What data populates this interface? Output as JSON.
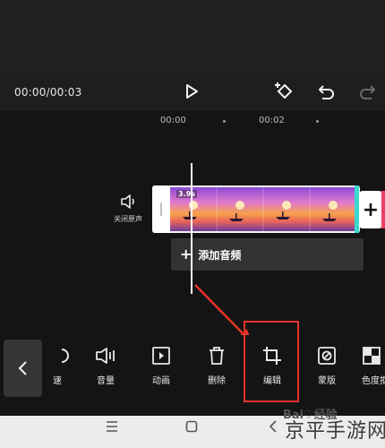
{
  "player": {
    "timecode": "00:00/00:03"
  },
  "controls": {
    "play_icon": "play-icon",
    "keyframe_icon": "keyframe-add-icon",
    "undo_icon": "undo-icon",
    "redo_icon": "redo-icon"
  },
  "ruler": {
    "ticks": [
      "00:00",
      "00:02"
    ]
  },
  "track": {
    "mute_label": "关闭原声",
    "clip_duration": "3.9s",
    "add_button": "+",
    "add_audio_plus": "+",
    "add_audio_label": "添加音频"
  },
  "toolbar": {
    "items": [
      {
        "label": "速",
        "icon": "speed-icon"
      },
      {
        "label": "音量",
        "icon": "volume-icon"
      },
      {
        "label": "动画",
        "icon": "animation-icon"
      },
      {
        "label": "删除",
        "icon": "trash-icon"
      },
      {
        "label": "编辑",
        "icon": "crop-icon"
      },
      {
        "label": "蒙版",
        "icon": "mask-icon"
      },
      {
        "label": "色度抠",
        "icon": "chroma-icon"
      }
    ],
    "highlight_color": "#e8332b"
  },
  "watermark": {
    "site": "京平手游网",
    "baidu": "Bai♡经验"
  },
  "colors": {
    "accent_cyan": "#3ad9d0",
    "accent_pink": "#ee3d63",
    "annotation_red": "#e8332b"
  }
}
